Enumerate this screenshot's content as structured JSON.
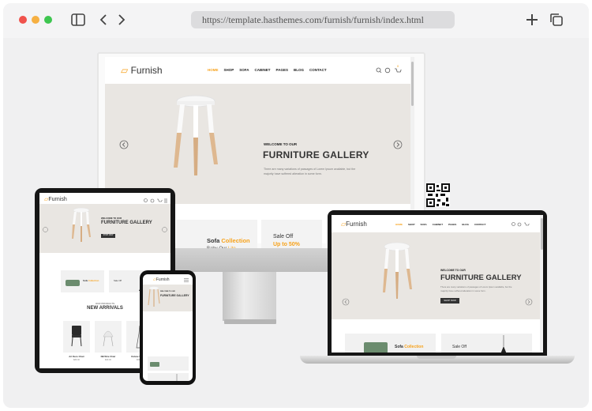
{
  "browser": {
    "url": "https://template.hasthemes.com/furnish/furnish/index.html",
    "dot_colors": [
      "#f0524c",
      "#f6b042",
      "#3ec650"
    ]
  },
  "site": {
    "logo": "Furnish",
    "nav": [
      "HOME",
      "SHOP",
      "SOFA",
      "CABINET",
      "PAGES",
      "BLOG",
      "CONTACT"
    ],
    "cart_count": "0",
    "hero": {
      "kicker": "WELCOME TO OUR",
      "title": "FURNITURE GALLERY",
      "text_line1": "There are many variations of passages of Lorem Ipsum available, but the",
      "text_line2": "majority have suffered alteration in some form.",
      "button": "SHOP NOW"
    },
    "banner_sofa": {
      "title": "Sofa",
      "highlight": "Collection",
      "subtitle": "Baby Our",
      "subtitle_highlight": "Lite"
    },
    "banner_sale": {
      "title": "Sale Off",
      "highlight": "Up to 50%"
    },
    "new_arrivals": {
      "kicker": "OUR PRODUCTS",
      "title": "NEW ARRIVALS"
    },
    "products": [
      {
        "name": "Art Deco Chair",
        "price": "$89.00"
      },
      {
        "name": "NB Wire Chair",
        "price": "$69.00"
      },
      {
        "name": "Deluxe Sofa Set",
        "price": "$99.00"
      }
    ]
  },
  "colors": {
    "accent": "#f7a21b",
    "hero_bg": "#e9e6e2",
    "dark": "#333333"
  }
}
